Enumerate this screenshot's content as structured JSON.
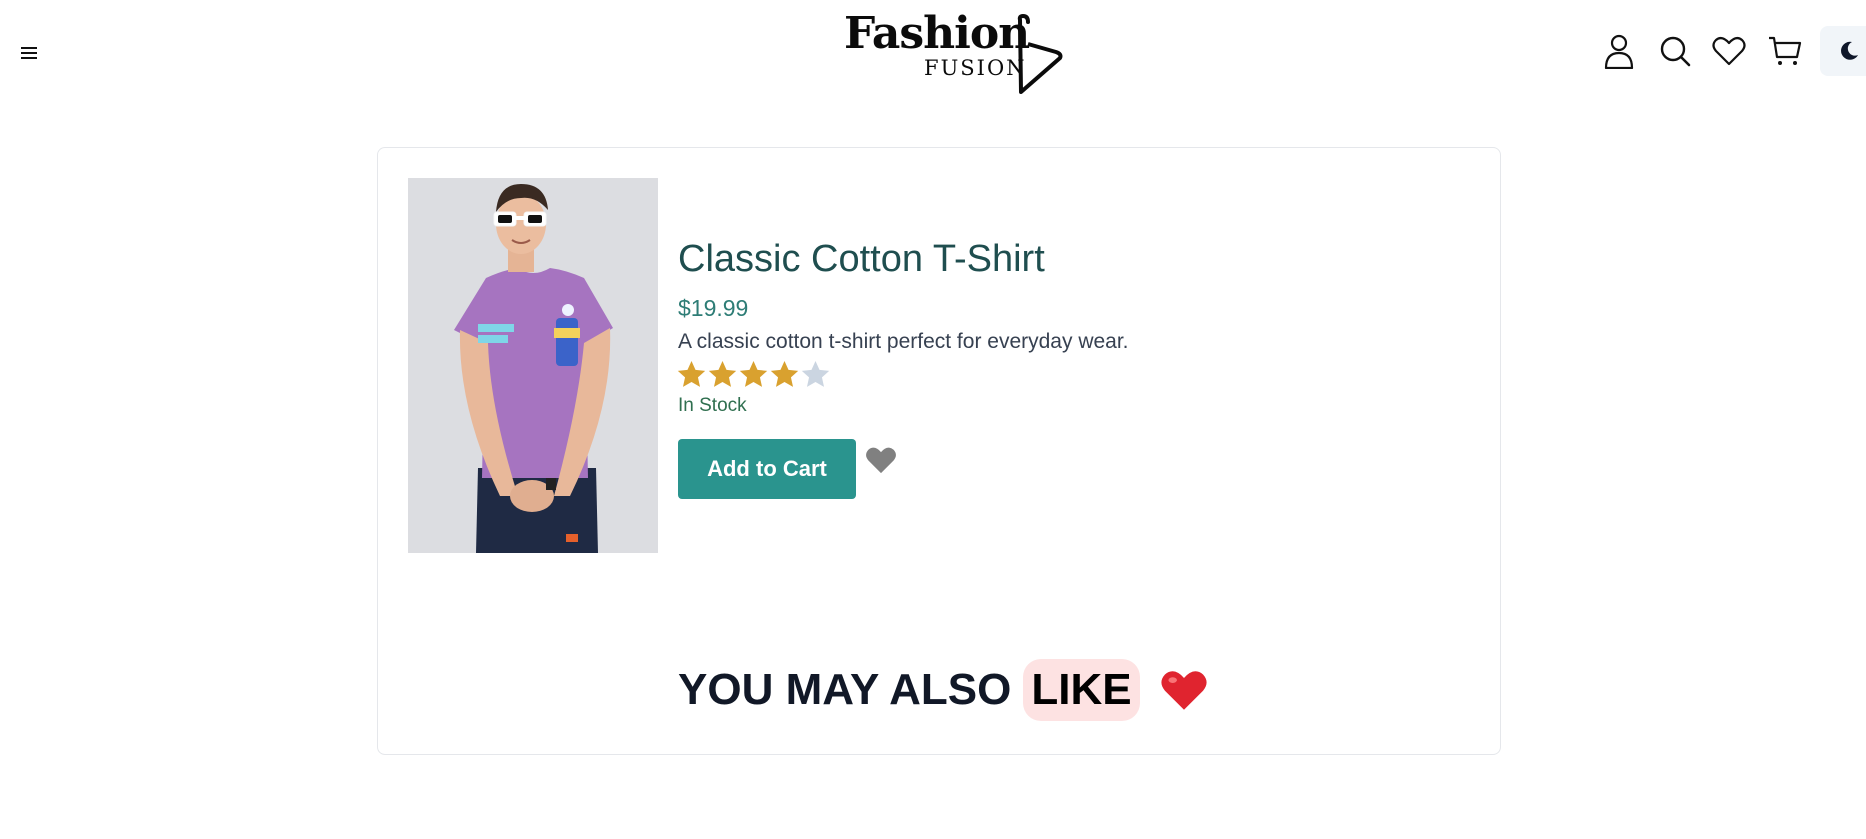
{
  "header": {
    "menu_icon": "hamburger-icon",
    "logo": {
      "word1": "Fashion",
      "word2": "FUSION",
      "icon": "hanger-icon"
    },
    "icons": [
      "user-icon",
      "search-icon",
      "heart-icon",
      "cart-icon",
      "moon-icon"
    ]
  },
  "product": {
    "title": "Classic Cotton T-Shirt",
    "price": "$19.99",
    "description": "A classic cotton t-shirt perfect for everyday wear.",
    "rating": 4,
    "rating_max": 5,
    "stock": "In Stock",
    "add_to_cart_label": "Add to Cart"
  },
  "recommendations": {
    "heading": "YOU MAY ALSO",
    "heading_highlight": "LIKE",
    "emoji": "heart-emoji"
  },
  "colors": {
    "accent": "#2a948e",
    "title": "#1f4e4f",
    "star_filled": "#d9a12f",
    "star_empty": "#cbd5e1",
    "highlight": "#fde2e2"
  }
}
